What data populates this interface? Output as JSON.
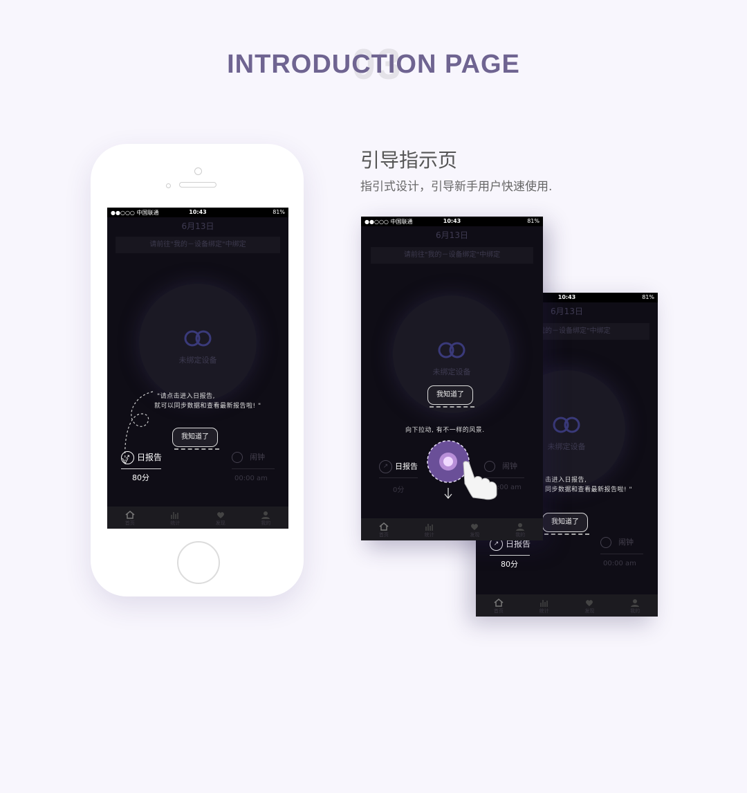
{
  "header": {
    "number": "03",
    "title": "INTRODUCTION PAGE",
    "section_title": "引导指示页",
    "section_subtitle": "指引式设计，引导新手用户快速使用."
  },
  "status_bar": {
    "carrier": "●●○○○ 中国联通",
    "time": "10:43",
    "battery": "81%"
  },
  "screen": {
    "date": "6月13日",
    "bind_banner": "请前往\"我的－设备绑定\"中绑定",
    "bind_banner_partial": "我的－设备绑定\"中绑定",
    "unbound_label": "未绑定设备",
    "report_label": "日报告",
    "report_score": "80分",
    "report_score_zero": "0分",
    "alarm_label": "闹钟",
    "alarm_time": "00:00 am"
  },
  "guide": {
    "hint_report_line1": "\"请点击进入日报告,",
    "hint_report_line2": "就可以同步数据和查看最新报告啦! \"",
    "hint_report_partial_line1": "击进入日报告,",
    "hint_report_partial_line2": "同步数据和查看最新报告啦! \"",
    "hint_pull": "向下拉动, 有不一样的风景.",
    "got_it_button": "我知道了"
  },
  "tabbar": {
    "tabs": [
      {
        "label": "首页",
        "icon": "home-icon"
      },
      {
        "label": "统计",
        "icon": "stats-icon"
      },
      {
        "label": "发现",
        "icon": "discover-icon"
      },
      {
        "label": "我的",
        "icon": "user-icon"
      }
    ]
  },
  "colors": {
    "title": "#6f6491",
    "screen_bg": "#0f0d16",
    "accent": "#8a68c0"
  }
}
